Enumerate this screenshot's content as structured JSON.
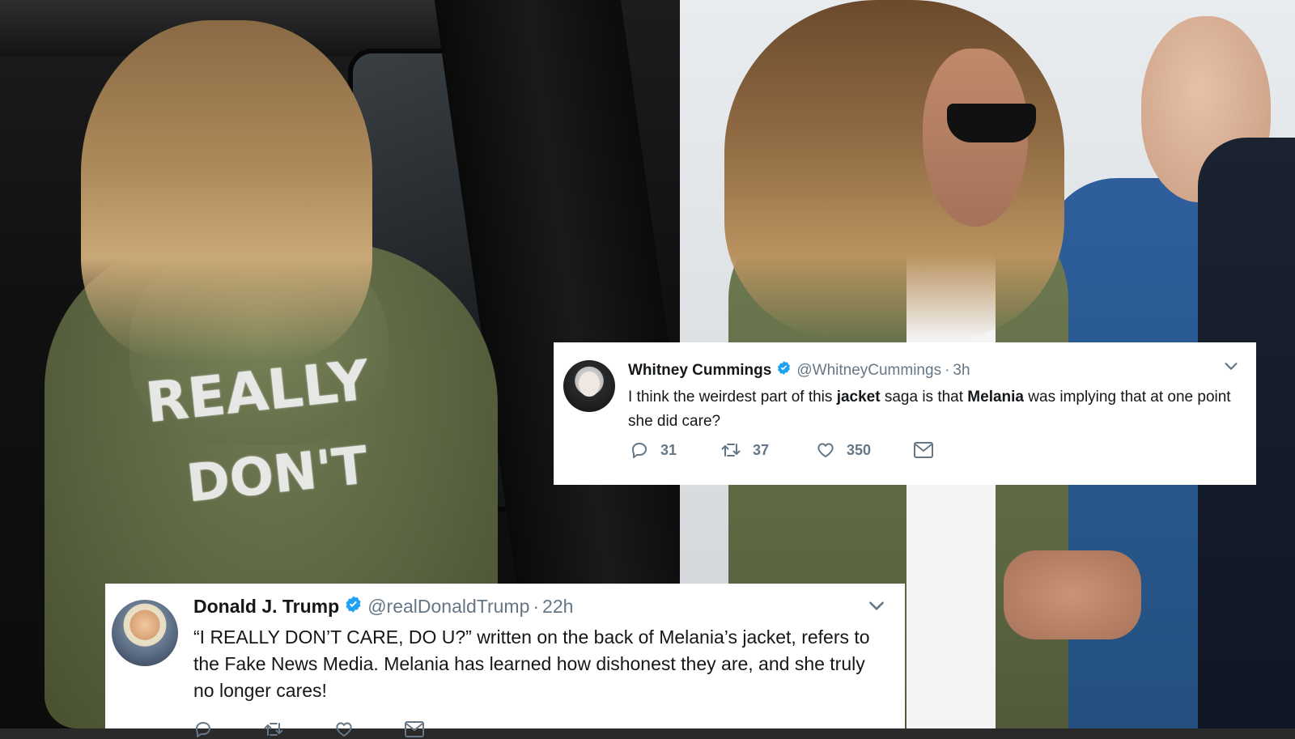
{
  "colors": {
    "verified_blue": "#1da1f2",
    "text_primary": "#14171a",
    "text_secondary": "#657786",
    "card_bg": "#ffffff"
  },
  "photo": {
    "jacket_graffiti": [
      "REALLY",
      "DON'T"
    ]
  },
  "tweets": [
    {
      "name": "Whitney Cummings",
      "verified": true,
      "handle": "@WhitneyCummings",
      "separator": "·",
      "time": "3h",
      "text_parts": [
        {
          "t": "I think the weirdest part of this ",
          "bold": false
        },
        {
          "t": "jacket",
          "bold": true
        },
        {
          "t": " saga is that ",
          "bold": false
        },
        {
          "t": "Melania",
          "bold": true
        },
        {
          "t": " was implying that at one point she did care?",
          "bold": false
        }
      ],
      "actions": {
        "replies": "31",
        "retweets": "37",
        "likes": "350"
      },
      "icons": [
        "reply-icon",
        "retweet-icon",
        "like-icon",
        "mail-icon",
        "chevron-down-icon",
        "verified-icon"
      ]
    },
    {
      "name": "Donald J. Trump",
      "verified": true,
      "handle": "@realDonaldTrump",
      "separator": "·",
      "time": "22h",
      "text": "“I REALLY DON’T CARE, DO U?” written on the back of Melania’s jacket, refers to the Fake News Media. Melania has learned how dishonest they are, and she truly no longer cares!",
      "icons": [
        "reply-icon",
        "retweet-icon",
        "like-icon",
        "mail-icon",
        "chevron-down-icon",
        "verified-icon"
      ]
    }
  ]
}
